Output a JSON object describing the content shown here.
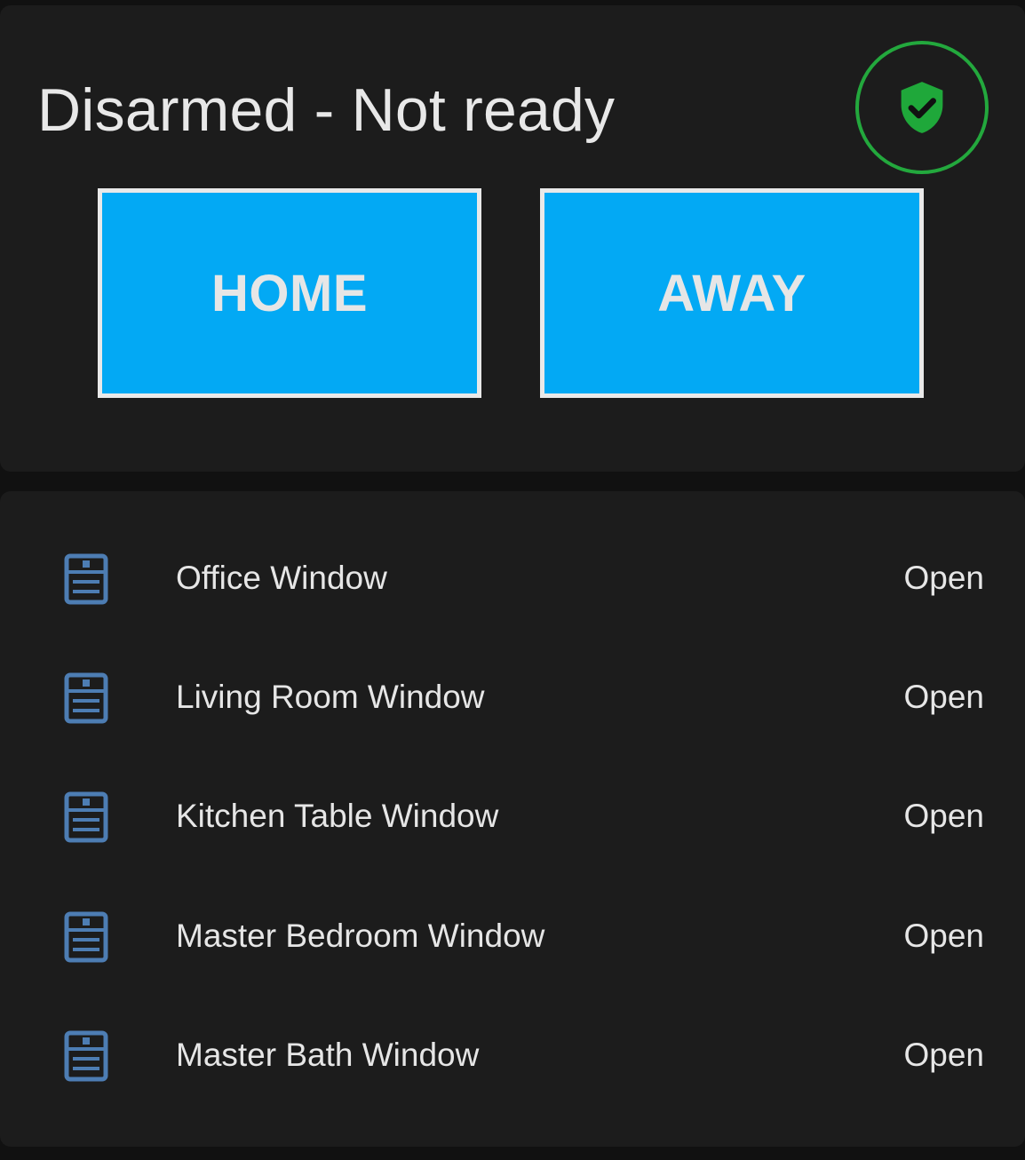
{
  "alarm_panel": {
    "status_title": "Disarmed - Not ready",
    "badge_icon": "shield-check-icon",
    "badge_color": "#23a83d",
    "buttons": {
      "home_label": "HOME",
      "away_label": "AWAY",
      "button_color": "#03a9f4"
    }
  },
  "sensors": {
    "icon": "window-closed-icon",
    "icon_color": "#4d7db3",
    "items": [
      {
        "name": "Office Window",
        "state": "Open"
      },
      {
        "name": "Living Room Window",
        "state": "Open"
      },
      {
        "name": "Kitchen Table Window",
        "state": "Open"
      },
      {
        "name": "Master Bedroom Window",
        "state": "Open"
      },
      {
        "name": "Master Bath Window",
        "state": "Open"
      }
    ]
  }
}
